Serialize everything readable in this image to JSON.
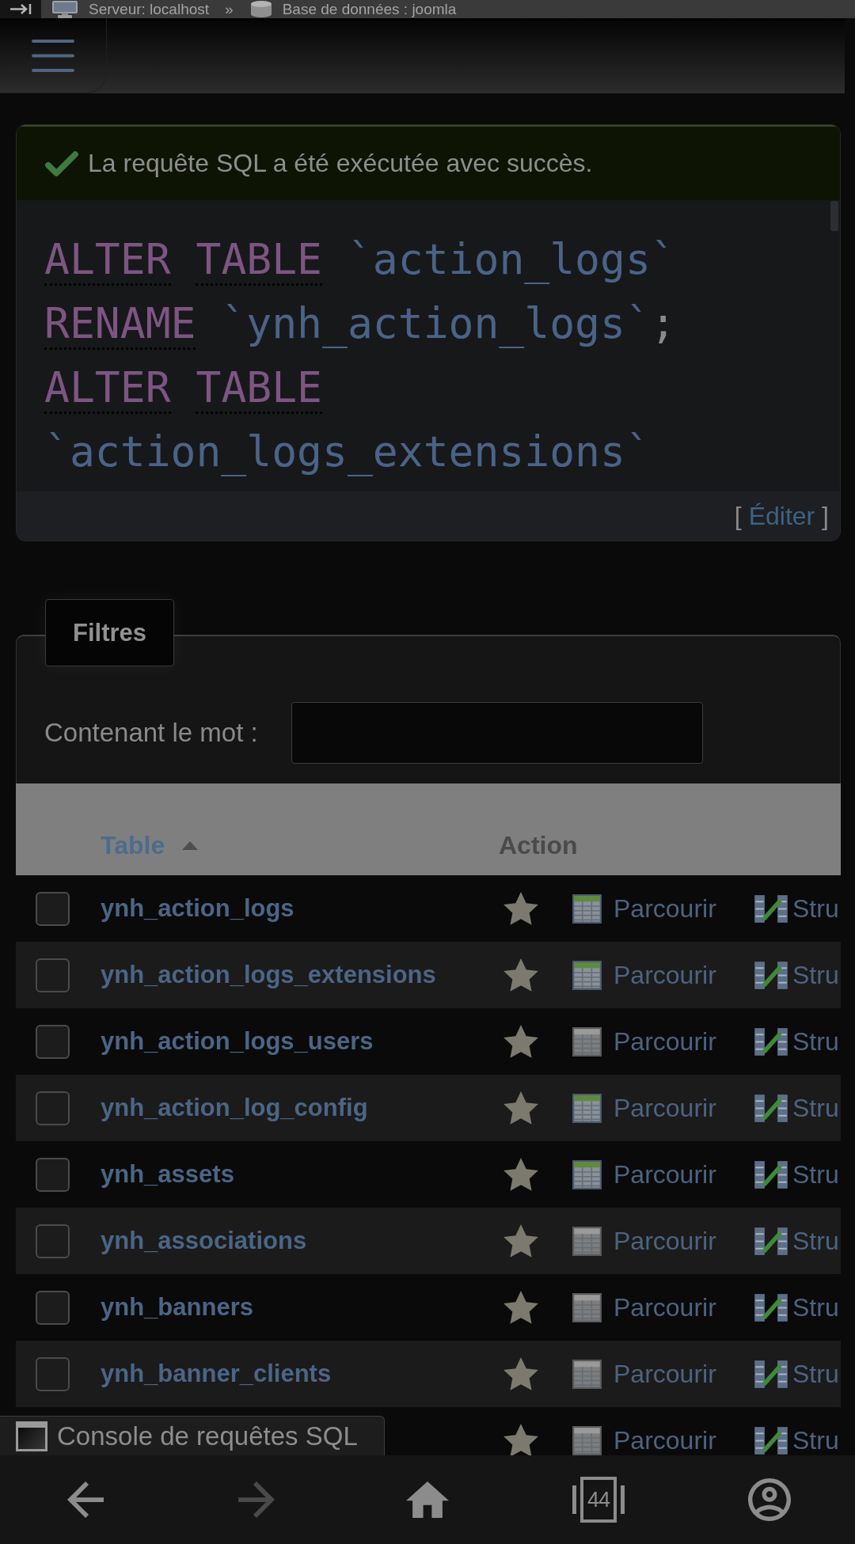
{
  "breadcrumb": [
    {
      "kind": "server",
      "label": "Serveur: localhost"
    },
    {
      "kind": "database",
      "label": "Base de données : joomla"
    }
  ],
  "breadcrumb_separator": "»",
  "message": {
    "kind": "success",
    "text": "La requête SQL a été exécutée avec succès."
  },
  "sql": {
    "lines": [
      [
        {
          "kind": "keyword",
          "text": "ALTER"
        },
        {
          "kind": "keyword",
          "text": "TABLE"
        },
        {
          "kind": "identifier",
          "text": "`action_logs`"
        }
      ],
      [
        {
          "kind": "keyword",
          "text": "RENAME"
        },
        {
          "kind": "identifier",
          "text": "`ynh_action_logs`"
        },
        {
          "kind": "punctuation",
          "text": ";"
        }
      ],
      [
        {
          "kind": "keyword",
          "text": "ALTER"
        },
        {
          "kind": "keyword",
          "text": "TABLE"
        }
      ],
      [
        {
          "kind": "identifier",
          "text": "`action_logs_extensions`"
        }
      ]
    ],
    "edit": {
      "before": "[",
      "link": "Éditer",
      "after": "]"
    }
  },
  "filters": {
    "legend": "Filtres",
    "label": "Contenant le mot :"
  },
  "table": {
    "columns": [
      {
        "label": "Table",
        "sorted": true
      },
      {
        "label": "Action",
        "sorted": false
      }
    ],
    "rows": [
      {
        "name": "ynh_action_logs",
        "checked": false,
        "empty": false,
        "browse": "Parcourir",
        "structure": "Stru"
      },
      {
        "name": "ynh_action_logs_extensions",
        "checked": false,
        "empty": false,
        "browse": "Parcourir",
        "structure": "Stru"
      },
      {
        "name": "ynh_action_logs_users",
        "checked": false,
        "empty": true,
        "browse": "Parcourir",
        "structure": "Stru"
      },
      {
        "name": "ynh_action_log_config",
        "checked": false,
        "empty": false,
        "browse": "Parcourir",
        "structure": "Stru"
      },
      {
        "name": "ynh_assets",
        "checked": false,
        "empty": false,
        "browse": "Parcourir",
        "structure": "Stru"
      },
      {
        "name": "ynh_associations",
        "checked": false,
        "empty": true,
        "browse": "Parcourir",
        "structure": "Stru"
      },
      {
        "name": "ynh_banners",
        "checked": false,
        "empty": true,
        "browse": "Parcourir",
        "structure": "Stru"
      },
      {
        "name": "ynh_banner_clients",
        "checked": false,
        "empty": true,
        "browse": "Parcourir",
        "structure": "Stru"
      },
      {
        "empty": true,
        "browse": "Parcourir",
        "structure": "Stru"
      }
    ]
  },
  "console": {
    "label": "Console de requêtes SQL"
  },
  "bottom_nav": [
    {
      "kind": "back",
      "disabled": false
    },
    {
      "kind": "forward",
      "disabled": true
    },
    {
      "kind": "home",
      "disabled": false
    },
    {
      "kind": "tabs",
      "count": "44",
      "disabled": false
    },
    {
      "kind": "account",
      "disabled": false
    }
  ]
}
